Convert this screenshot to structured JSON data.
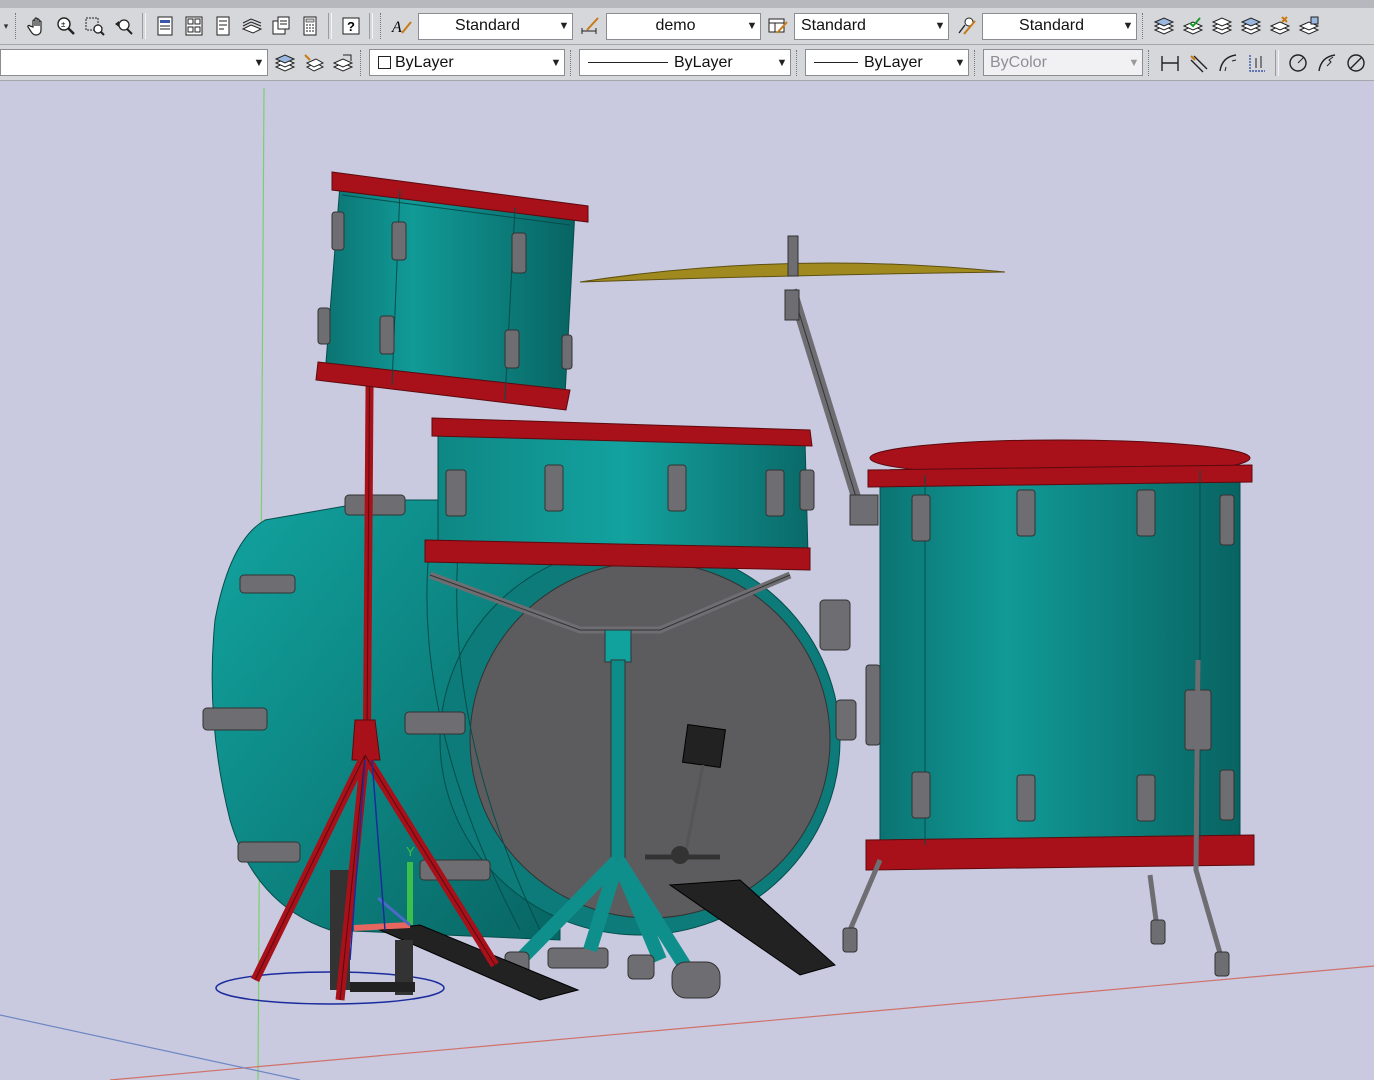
{
  "toolbar_top": {
    "text_style": "Standard",
    "dim_style": "demo",
    "table_style": "Standard",
    "multileader_style": "Standard",
    "icons": [
      "pan-icon",
      "zoom-realtime-icon",
      "zoom-window-icon",
      "zoom-previous-icon",
      "properties-icon",
      "design-center-icon",
      "tool-palettes-icon",
      "sheet-set-icon",
      "markup-icon",
      "calculator-icon",
      "help-icon",
      "text-style-icon",
      "dim-style-icon",
      "table-style-icon",
      "multileader-style-icon",
      "layer-states-icon",
      "layer-match-icon",
      "layer-previous-icon",
      "layer-isolate-icon",
      "layer-freeze-icon",
      "layer-walk-icon"
    ]
  },
  "toolbar_bottom": {
    "layer_value": "",
    "color": "ByLayer",
    "linetype": "ByLayer",
    "lineweight": "ByLayer",
    "plot_style": "ByColor",
    "icons": [
      "layer-properties-icon",
      "make-current-icon",
      "layer-previous-icon",
      "linear-dim-icon",
      "aligned-dim-icon",
      "arc-length-icon",
      "ordinate-dim-icon",
      "radius-dim-icon",
      "jogged-dim-icon",
      "diameter-dim-icon"
    ]
  },
  "viewport": {
    "ucs_y_label": "Y",
    "colors": {
      "shell": "#0e8a88",
      "shell_dark": "#0a6f6e",
      "hoop": "#a8101a",
      "hardware": "#6e6e72",
      "head": "#5c5c5e",
      "cymbal": "#a08a20",
      "bg": "#c9cae0"
    }
  }
}
